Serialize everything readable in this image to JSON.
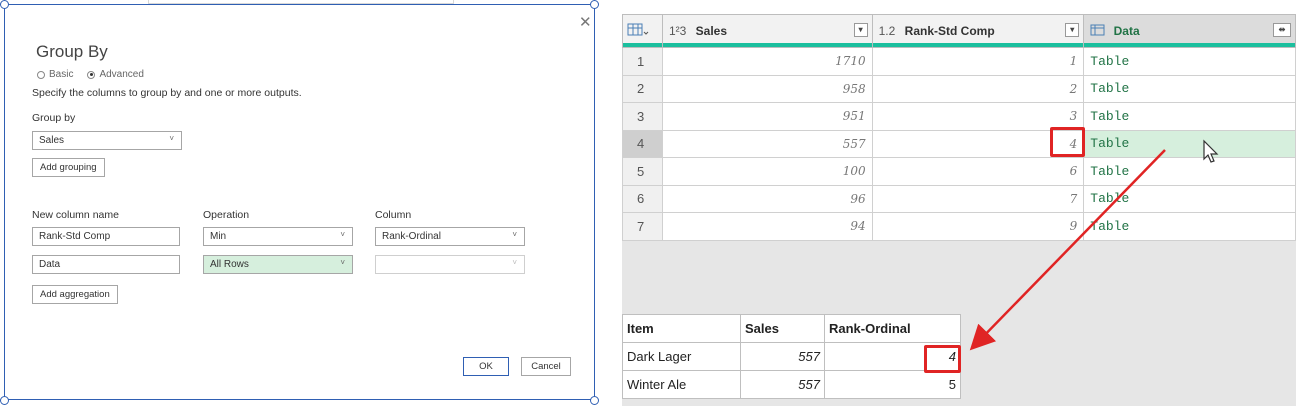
{
  "dialog": {
    "title": "Group By",
    "mode_basic": "Basic",
    "mode_advanced": "Advanced",
    "description": "Specify the columns to group by and one or more outputs.",
    "group_by_label": "Group by",
    "group_by_value": "Sales",
    "add_grouping": "Add grouping",
    "col_new_name": "New column name",
    "col_operation": "Operation",
    "col_column": "Column",
    "agg_rows": [
      {
        "name": "Rank-Std Comp",
        "operation": "Min",
        "column": "Rank-Ordinal"
      },
      {
        "name": "Data",
        "operation": "All Rows",
        "column": ""
      }
    ],
    "add_aggregation": "Add aggregation",
    "ok": "OK",
    "cancel": "Cancel"
  },
  "grid": {
    "headers": {
      "sales_type": "1²3",
      "sales": "Sales",
      "rank_type": "1.2",
      "rank": "Rank-Std Comp",
      "data": "Data"
    },
    "rows": [
      {
        "n": "1",
        "sales": "1710",
        "rank": "1",
        "data": "Table"
      },
      {
        "n": "2",
        "sales": "958",
        "rank": "2",
        "data": "Table"
      },
      {
        "n": "3",
        "sales": "951",
        "rank": "3",
        "data": "Table"
      },
      {
        "n": "4",
        "sales": "557",
        "rank": "4",
        "data": "Table"
      },
      {
        "n": "5",
        "sales": "100",
        "rank": "6",
        "data": "Table"
      },
      {
        "n": "6",
        "sales": "96",
        "rank": "7",
        "data": "Table"
      },
      {
        "n": "7",
        "sales": "94",
        "rank": "9",
        "data": "Table"
      }
    ]
  },
  "detail_table": {
    "headers": [
      "Item",
      "Sales",
      "Rank-Ordinal"
    ],
    "rows": [
      {
        "item": "Dark Lager",
        "sales": "557",
        "rank": "4"
      },
      {
        "item": "Winter Ale",
        "sales": "557",
        "rank": "5"
      }
    ]
  },
  "colors": {
    "accent_green": "#217346",
    "highlight_red": "#e02424",
    "dialog_border": "#2f5fb3"
  }
}
